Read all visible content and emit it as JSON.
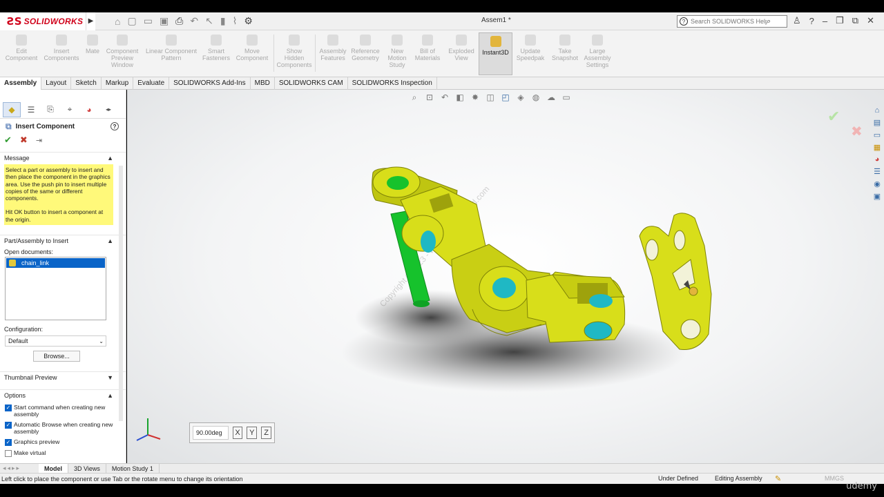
{
  "window": {
    "app_name": "SOLIDWORKS",
    "document_title": "Assem1 *",
    "help_search_placeholder": "Search SOLIDWORKS Help"
  },
  "command_manager": [
    {
      "label": "Edit Component",
      "active": false
    },
    {
      "label": "Insert Components",
      "active": false
    },
    {
      "label": "Mate",
      "active": false
    },
    {
      "label": "Component Preview Window",
      "active": false
    },
    {
      "label": "Linear Component Pattern",
      "active": false
    },
    {
      "label": "Smart Fasteners",
      "active": false
    },
    {
      "label": "Move Component",
      "active": false
    },
    {
      "label": "Show Hidden Components",
      "active": false
    },
    {
      "label": "Assembly Features",
      "active": false
    },
    {
      "label": "Reference Geometry",
      "active": false
    },
    {
      "label": "New Motion Study",
      "active": false
    },
    {
      "label": "Bill of Materials",
      "active": false
    },
    {
      "label": "Exploded View",
      "active": false
    },
    {
      "label": "Instant3D",
      "active": true
    },
    {
      "label": "Update Speedpak",
      "active": false
    },
    {
      "label": "Take Snapshot",
      "active": false
    },
    {
      "label": "Large Assembly Settings",
      "active": false
    }
  ],
  "tabs": [
    "Assembly",
    "Layout",
    "Sketch",
    "Markup",
    "Evaluate",
    "SOLIDWORKS Add-Ins",
    "MBD",
    "SOLIDWORKS CAM",
    "SOLIDWORKS Inspection"
  ],
  "property_manager": {
    "title": "Insert Component",
    "message_header": "Message",
    "message_p1": "Select a part or assembly to insert and then place the component in the graphics area. Use the push pin to insert multiple copies of the same or different components.",
    "message_p2": "Hit OK button to insert a component at the origin.",
    "part_header": "Part/Assembly to Insert",
    "open_docs_label": "Open documents:",
    "open_docs": [
      "chain_link"
    ],
    "config_label": "Configuration:",
    "config_value": "Default",
    "browse_label": "Browse...",
    "thumbnail_header": "Thumbnail Preview",
    "options_header": "Options",
    "options": [
      {
        "label": "Start command when creating new assembly",
        "checked": true
      },
      {
        "label": "Automatic Browse when creating new assembly",
        "checked": true
      },
      {
        "label": "Graphics preview",
        "checked": true
      },
      {
        "label": "Make virtual",
        "checked": false
      }
    ]
  },
  "graphics": {
    "angle_value": "90.00deg",
    "rotate_buttons": [
      "X",
      "Y",
      "Z"
    ],
    "watermark": "Copyright © 2023 - www.p30download.com"
  },
  "bottom_tabs": [
    "Model",
    "3D Views",
    "Motion Study 1"
  ],
  "status": {
    "hint": "Left click to place the component or use Tab or the rotate menu to change its orientation",
    "definition": "Under Defined",
    "mode": "Editing Assembly",
    "units": "MMGS"
  },
  "watermark_corner": "udemy",
  "colors": {
    "part_yellow": "#d8de1a",
    "hole_cyan": "#1fb8c4",
    "pin_green": "#16c22c",
    "message_bg": "#fff97a",
    "selection_blue": "#0a64c8",
    "brand_red": "#d0021b"
  }
}
